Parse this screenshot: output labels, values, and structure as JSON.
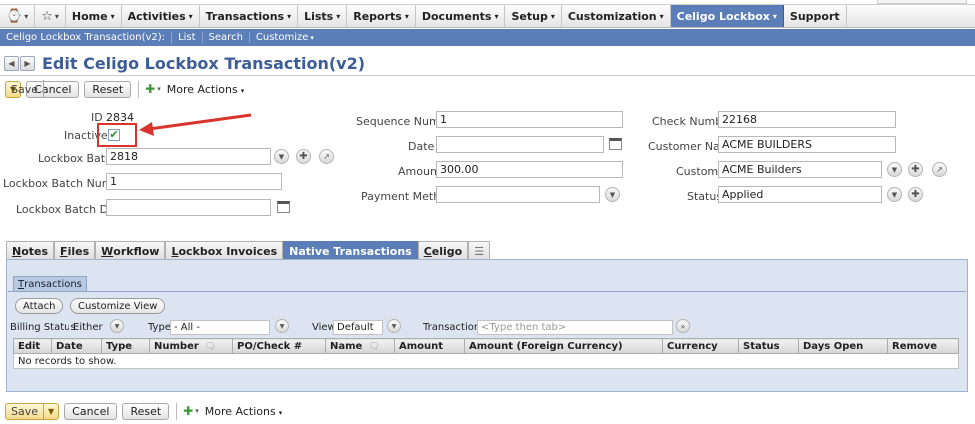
{
  "topnav": {
    "items": [
      {
        "label": "Home",
        "caret": "▾"
      },
      {
        "label": "Activities",
        "caret": "▾"
      },
      {
        "label": "Transactions",
        "caret": "▾"
      },
      {
        "label": "Lists",
        "caret": "▾"
      },
      {
        "label": "Reports",
        "caret": "▾"
      },
      {
        "label": "Documents",
        "caret": "▾"
      },
      {
        "label": "Setup",
        "caret": "▾"
      },
      {
        "label": "Customization",
        "caret": "▾"
      },
      {
        "label": "Celigo Lockbox",
        "caret": "▾"
      },
      {
        "label": "Support",
        "caret": ""
      }
    ],
    "recent_icon": "recent-icon",
    "star_icon": "star-icon"
  },
  "subnav": {
    "record": "Celigo Lockbox Transaction(v2):",
    "list": "List",
    "search": "Search",
    "customize": "Customize"
  },
  "page": {
    "title": "Edit Celigo Lockbox Transaction(v2)"
  },
  "toolbar": {
    "save": "Save",
    "cancel": "Cancel",
    "reset": "Reset",
    "more_actions": "More Actions"
  },
  "form": {
    "id_label": "ID",
    "id_value": "2834",
    "inactive_label": "Inactive",
    "inactive_checked": "✔",
    "lockbox_batch_label": "Lockbox Batch",
    "lockbox_batch_value": "2818",
    "lockbox_batch_number_label": "Lockbox Batch Number",
    "lockbox_batch_number_value": "1",
    "lockbox_batch_date_label": "Lockbox Batch Date",
    "lockbox_batch_date_value": "",
    "sequence_number_label": "Sequence Number",
    "sequence_number_value": "1",
    "date_label": "Date",
    "date_value": "",
    "amount_label": "Amount",
    "amount_value": "300.00",
    "payment_method_label": "Payment Method",
    "payment_method_value": "",
    "check_number_label": "Check Number",
    "check_number_value": "22168",
    "customer_name_label": "Customer Name",
    "customer_name_value": "ACME BUILDERS",
    "customer_label": "Customer",
    "customer_value": "ACME Builders",
    "status_label": "Status",
    "status_value": "Applied"
  },
  "tabs": {
    "notes": {
      "u": "N",
      "rest": "otes"
    },
    "files": {
      "u": "F",
      "rest": "iles"
    },
    "workflow": {
      "u": "W",
      "rest": "orkflow"
    },
    "lockbox_invoices": {
      "u": "L",
      "rest": "ockbox Invoices"
    },
    "native_transactions": {
      "u": "N",
      "rest": "ative Transactions"
    },
    "celigo": {
      "u": "C",
      "rest": "eligo"
    }
  },
  "subtab": {
    "u": "T",
    "rest": "ransactions"
  },
  "sublist": {
    "attach": "Attach",
    "customize_view": "Customize View",
    "billing_status_label": "Billing Status",
    "billing_status_value": "Either",
    "type_label": "Type",
    "type_value": "- All -",
    "view_label": "View",
    "view_value": "Default",
    "transaction_label": "Transaction",
    "transaction_placeholder": "<Type then tab>",
    "columns": [
      "Edit",
      "Date",
      "Type",
      "Number",
      "PO/Check #",
      "Name",
      "Amount",
      "Amount (Foreign Currency)",
      "Currency",
      "Status",
      "Days Open",
      "Remove"
    ],
    "empty_message": "No records to show."
  }
}
